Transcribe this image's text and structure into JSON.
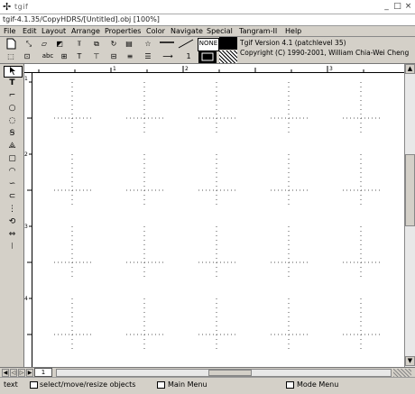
{
  "window": {
    "title": "tgif",
    "file_path": "tgif-4.1.35/CopyHDRS/[Untitled].obj [100%]"
  },
  "menu": [
    "File",
    "Edit",
    "Layout",
    "Arrange",
    "Properties",
    "Color",
    "Navigate",
    "Special",
    "Tangram-II",
    "Help"
  ],
  "toolbar": {
    "text_tool": "abc",
    "none_label": "NONE",
    "line_width": "1",
    "version": "Tgif Version 4.1 (patchlevel 35)",
    "copyright": "Copyright (C) 1990-2001, William Chia-Wei Cheng"
  },
  "ruler": {
    "top_labels": [
      "1",
      "2",
      "3"
    ],
    "left_labels": [
      "1",
      "2",
      "3",
      "4"
    ]
  },
  "tabs": {
    "page": "1"
  },
  "status": {
    "mode": "text",
    "left_message": "select/move/resize objects",
    "middle_message": "Main Menu",
    "right_message": "Mode Menu"
  },
  "colors": {
    "chrome": "#d4d0c8",
    "canvas": "#ffffff",
    "grid_dot": "#555555"
  }
}
